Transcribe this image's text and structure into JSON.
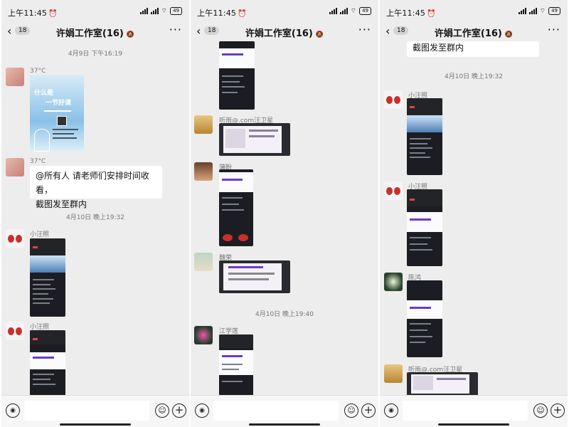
{
  "status": {
    "time": "上午11:45",
    "battery": "49"
  },
  "header": {
    "title": "许娟工作室(16)",
    "unread": "18"
  },
  "panes": {
    "p1": {
      "timestamps": [
        "4月9日 下午16:19",
        "4月10日 晚上19:32"
      ],
      "senders": [
        "37°C",
        "37°C",
        "小汪照",
        "小汪照"
      ],
      "message": {
        "line1": "@所有人  请老师们安排时间收看，",
        "line2": "截图发至群内"
      },
      "poster": {
        "line1": "什么是",
        "line2": "一节好课"
      }
    },
    "p2": {
      "timestamps": [
        "4月10日 晚上19:40"
      ],
      "senders": [
        "听雨@.com汪卫星",
        "蒲盼",
        "魏荣",
        "江学莲"
      ]
    },
    "p3": {
      "message_tail": "截图发至群内",
      "timestamps": [
        "4月10日 晚上19:32"
      ],
      "senders": [
        "小汪照",
        "小汪照",
        "陈鸿",
        "听雨@.com汪卫星"
      ]
    }
  },
  "colors": {
    "bg": "#ededed",
    "bubble": "#ffffff",
    "accent": "#6a3cc7"
  }
}
